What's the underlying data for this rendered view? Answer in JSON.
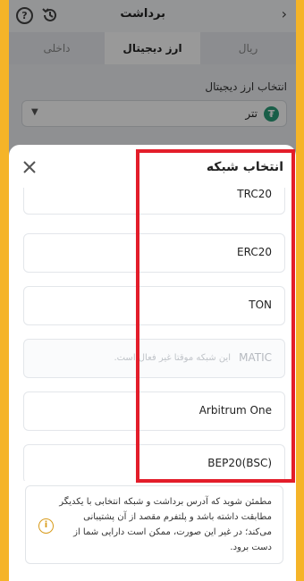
{
  "header": {
    "title": "برداشت",
    "back_icon": "chevron-right-icon",
    "help_symbol": "?",
    "history_icon": "history-icon"
  },
  "tabs": [
    {
      "label": "ریال",
      "active": false
    },
    {
      "label": "ارز دیجیتال",
      "active": true
    },
    {
      "label": "داخلی",
      "active": false
    }
  ],
  "currency_select": {
    "label": "انتخاب ارز دیجیتال",
    "value": "تتر",
    "icon_symbol": "₮",
    "caret": "▼"
  },
  "network_sheet": {
    "title": "انتخاب شبکه",
    "networks": [
      {
        "name": "TRC20",
        "disabled": false
      },
      {
        "name": "ERC20",
        "disabled": false
      },
      {
        "name": "TON",
        "disabled": false
      },
      {
        "name": "MATIC",
        "disabled": true,
        "note": "این شبکه موقتا غیر فعال است."
      },
      {
        "name": "Arbitrum One",
        "disabled": false
      },
      {
        "name": "BEP20(BSC)",
        "disabled": false
      }
    ],
    "warning": {
      "text": "مطمئن شوید که آدرس برداشت و شبکه انتخابی با یکدیگر مطابقت داشته باشد و پلتفرم مقصد از آن پشتیبانی می‌کند؛ در غیر این صورت، ممکن است دارایی شما از دست برود.",
      "icon_symbol": "i"
    }
  },
  "colors": {
    "accent": "#f5b428",
    "highlight": "#e31d2a",
    "tether": "#2a9d79",
    "warning": "#d89b1a"
  }
}
